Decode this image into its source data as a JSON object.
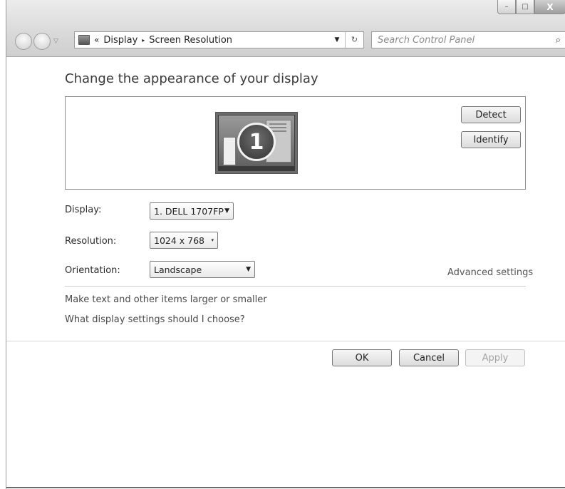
{
  "window": {
    "controls": {
      "minimize": "–",
      "maximize": "□",
      "close": "X"
    }
  },
  "address": {
    "overflow": "«",
    "crumbs": [
      "Display",
      "Screen Resolution"
    ],
    "separator": "▸"
  },
  "search": {
    "placeholder": "Search Control Panel",
    "icon": "⌕"
  },
  "main": {
    "heading": "Change the appearance of your display",
    "monitor_number": "1",
    "detect_label": "Detect",
    "identify_label": "Identify"
  },
  "settings": {
    "display_label": "Display:",
    "display_value": "1. DELL 1707FP",
    "resolution_label": "Resolution:",
    "resolution_value": "1024 x 768",
    "orientation_label": "Orientation:",
    "orientation_value": "Landscape",
    "advanced_link": "Advanced settings"
  },
  "links": {
    "text_size": "Make text and other items larger or smaller",
    "help": "What display settings should I choose?"
  },
  "footer": {
    "ok_label": "OK",
    "cancel_label": "Cancel",
    "apply_label": "Apply"
  }
}
